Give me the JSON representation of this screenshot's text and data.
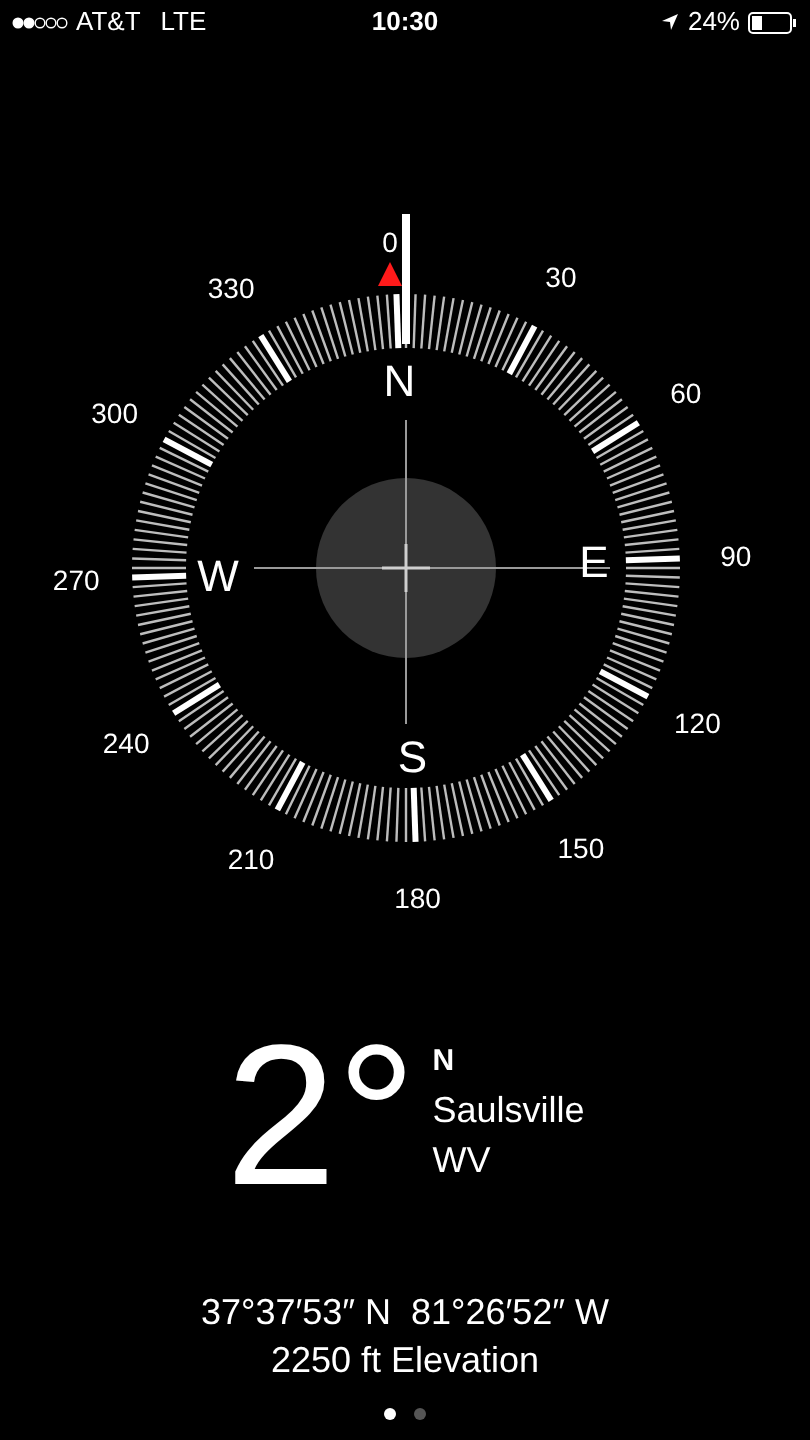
{
  "status_bar": {
    "carrier": "AT&T",
    "network": "LTE",
    "time": "10:30",
    "battery": "24%"
  },
  "compass": {
    "zero_label": "0",
    "degree_labels": [
      "30",
      "60",
      "90",
      "120",
      "150",
      "180",
      "210",
      "240",
      "270",
      "300",
      "330"
    ],
    "cardinals": [
      "N",
      "E",
      "S",
      "W"
    ]
  },
  "heading": {
    "degrees": "2°",
    "direction": "N",
    "place": "Saulsville",
    "region": "WV"
  },
  "coordinates": "37°37′53″ N  81°26′52″ W",
  "elevation": "2250 ft Elevation",
  "pages": [
    {
      "selected": true
    },
    {
      "selected": false
    }
  ]
}
